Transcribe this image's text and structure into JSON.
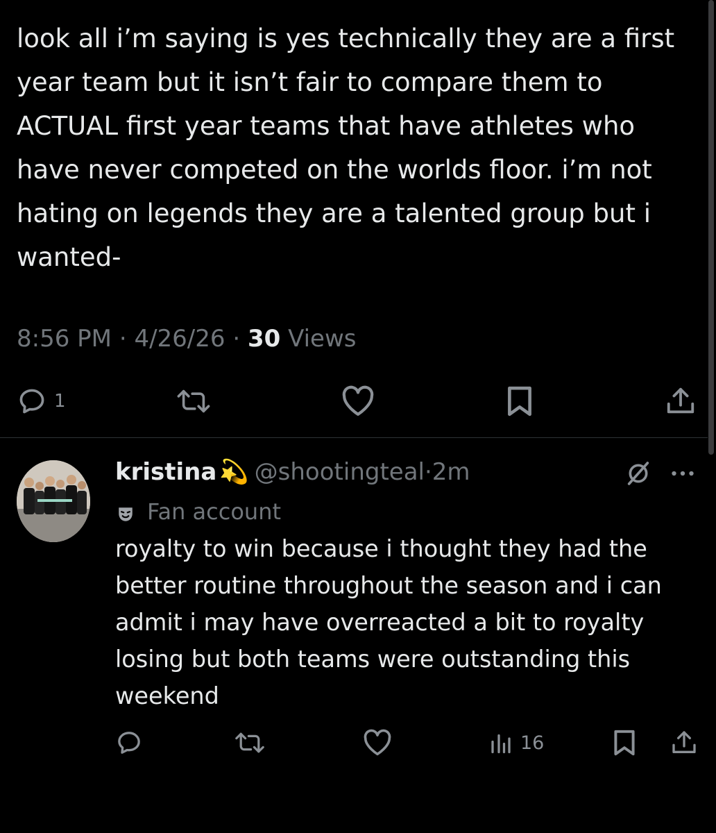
{
  "main_tweet": {
    "text": "look all i’m saying is yes technically they are a first year team but it isn’t fair to compare them to ACTUAL first year teams that have athletes who have never competed on the worlds floor. i’m not hating on legends they are a talented group but i wanted-",
    "time": "8:56 PM",
    "sep1": "·",
    "date": "4/26/26",
    "sep2": "·",
    "views_count": "30",
    "views_label": "Views",
    "reply_count": "1"
  },
  "reply": {
    "name": "kristina",
    "name_emoji": "💫",
    "handle": "@shootingteal",
    "sep": "·",
    "time": "2m",
    "label": "Fan account",
    "text": "royalty to win because i thought they had the better routine throughout the season and i can admit i may have overreacted a bit to royalty losing but both teams were outstanding this weekend",
    "views_count": "16"
  },
  "icons": {
    "reply": "reply-icon",
    "retweet": "retweet-icon",
    "like": "heart-icon",
    "bookmark": "bookmark-icon",
    "share": "share-icon",
    "views": "views-icon",
    "grok": "grok-icon",
    "more": "more-icon",
    "label": "theater-mask-icon"
  },
  "colors": {
    "background": "#000000",
    "text_primary": "#e7e9ea",
    "text_secondary": "#71767b",
    "divider": "#2f3336"
  }
}
